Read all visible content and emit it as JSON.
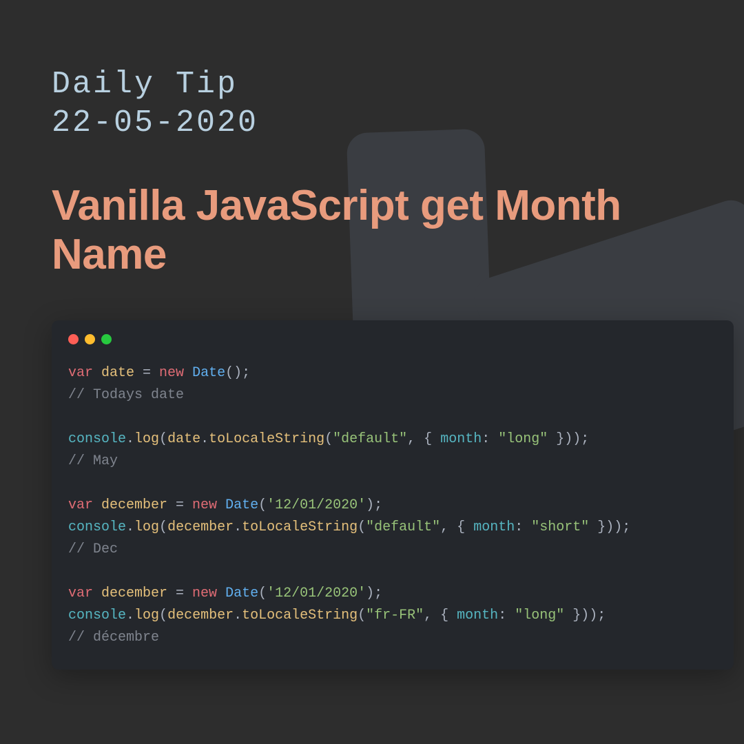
{
  "header": {
    "label": "Daily Tip",
    "date": "22-05-2020"
  },
  "title": "Vanilla JavaScript get Month Name",
  "code": {
    "lines": [
      {
        "tokens": [
          {
            "t": "var ",
            "c": "kw"
          },
          {
            "t": "date",
            "c": "var"
          },
          {
            "t": " = ",
            "c": "op"
          },
          {
            "t": "new ",
            "c": "kw"
          },
          {
            "t": "Date",
            "c": "cls"
          },
          {
            "t": "();",
            "c": "punc"
          }
        ]
      },
      {
        "tokens": [
          {
            "t": "// Todays date",
            "c": "cmt"
          }
        ]
      },
      {
        "tokens": []
      },
      {
        "tokens": [
          {
            "t": "console",
            "c": "obj"
          },
          {
            "t": ".",
            "c": "punc"
          },
          {
            "t": "log",
            "c": "fn"
          },
          {
            "t": "(",
            "c": "punc"
          },
          {
            "t": "date",
            "c": "var"
          },
          {
            "t": ".",
            "c": "punc"
          },
          {
            "t": "toLocaleString",
            "c": "fn"
          },
          {
            "t": "(",
            "c": "punc"
          },
          {
            "t": "\"default\"",
            "c": "str"
          },
          {
            "t": ", { ",
            "c": "punc"
          },
          {
            "t": "month",
            "c": "prop"
          },
          {
            "t": ": ",
            "c": "punc"
          },
          {
            "t": "\"long\"",
            "c": "str"
          },
          {
            "t": " }));",
            "c": "punc"
          }
        ]
      },
      {
        "tokens": [
          {
            "t": "// May",
            "c": "cmt"
          }
        ]
      },
      {
        "tokens": []
      },
      {
        "tokens": [
          {
            "t": "var ",
            "c": "kw"
          },
          {
            "t": "december",
            "c": "var"
          },
          {
            "t": " = ",
            "c": "op"
          },
          {
            "t": "new ",
            "c": "kw"
          },
          {
            "t": "Date",
            "c": "cls"
          },
          {
            "t": "(",
            "c": "punc"
          },
          {
            "t": "'12/01/2020'",
            "c": "str"
          },
          {
            "t": ");",
            "c": "punc"
          }
        ]
      },
      {
        "tokens": [
          {
            "t": "console",
            "c": "obj"
          },
          {
            "t": ".",
            "c": "punc"
          },
          {
            "t": "log",
            "c": "fn"
          },
          {
            "t": "(",
            "c": "punc"
          },
          {
            "t": "december",
            "c": "var"
          },
          {
            "t": ".",
            "c": "punc"
          },
          {
            "t": "toLocaleString",
            "c": "fn"
          },
          {
            "t": "(",
            "c": "punc"
          },
          {
            "t": "\"default\"",
            "c": "str"
          },
          {
            "t": ", { ",
            "c": "punc"
          },
          {
            "t": "month",
            "c": "prop"
          },
          {
            "t": ": ",
            "c": "punc"
          },
          {
            "t": "\"short\"",
            "c": "str"
          },
          {
            "t": " }));",
            "c": "punc"
          }
        ]
      },
      {
        "tokens": [
          {
            "t": "// Dec",
            "c": "cmt"
          }
        ]
      },
      {
        "tokens": []
      },
      {
        "tokens": [
          {
            "t": "var ",
            "c": "kw"
          },
          {
            "t": "december",
            "c": "var"
          },
          {
            "t": " = ",
            "c": "op"
          },
          {
            "t": "new ",
            "c": "kw"
          },
          {
            "t": "Date",
            "c": "cls"
          },
          {
            "t": "(",
            "c": "punc"
          },
          {
            "t": "'12/01/2020'",
            "c": "str"
          },
          {
            "t": ");",
            "c": "punc"
          }
        ]
      },
      {
        "tokens": [
          {
            "t": "console",
            "c": "obj"
          },
          {
            "t": ".",
            "c": "punc"
          },
          {
            "t": "log",
            "c": "fn"
          },
          {
            "t": "(",
            "c": "punc"
          },
          {
            "t": "december",
            "c": "var"
          },
          {
            "t": ".",
            "c": "punc"
          },
          {
            "t": "toLocaleString",
            "c": "fn"
          },
          {
            "t": "(",
            "c": "punc"
          },
          {
            "t": "\"fr-FR\"",
            "c": "str"
          },
          {
            "t": ", { ",
            "c": "punc"
          },
          {
            "t": "month",
            "c": "prop"
          },
          {
            "t": ": ",
            "c": "punc"
          },
          {
            "t": "\"long\"",
            "c": "str"
          },
          {
            "t": " }));",
            "c": "punc"
          }
        ]
      },
      {
        "tokens": [
          {
            "t": "// décembre",
            "c": "cmt"
          }
        ]
      }
    ]
  },
  "colors": {
    "background": "#2d2d2d",
    "accent_text": "#e89b7d",
    "header_text": "#b8d0e0",
    "code_bg": "#24272c"
  }
}
